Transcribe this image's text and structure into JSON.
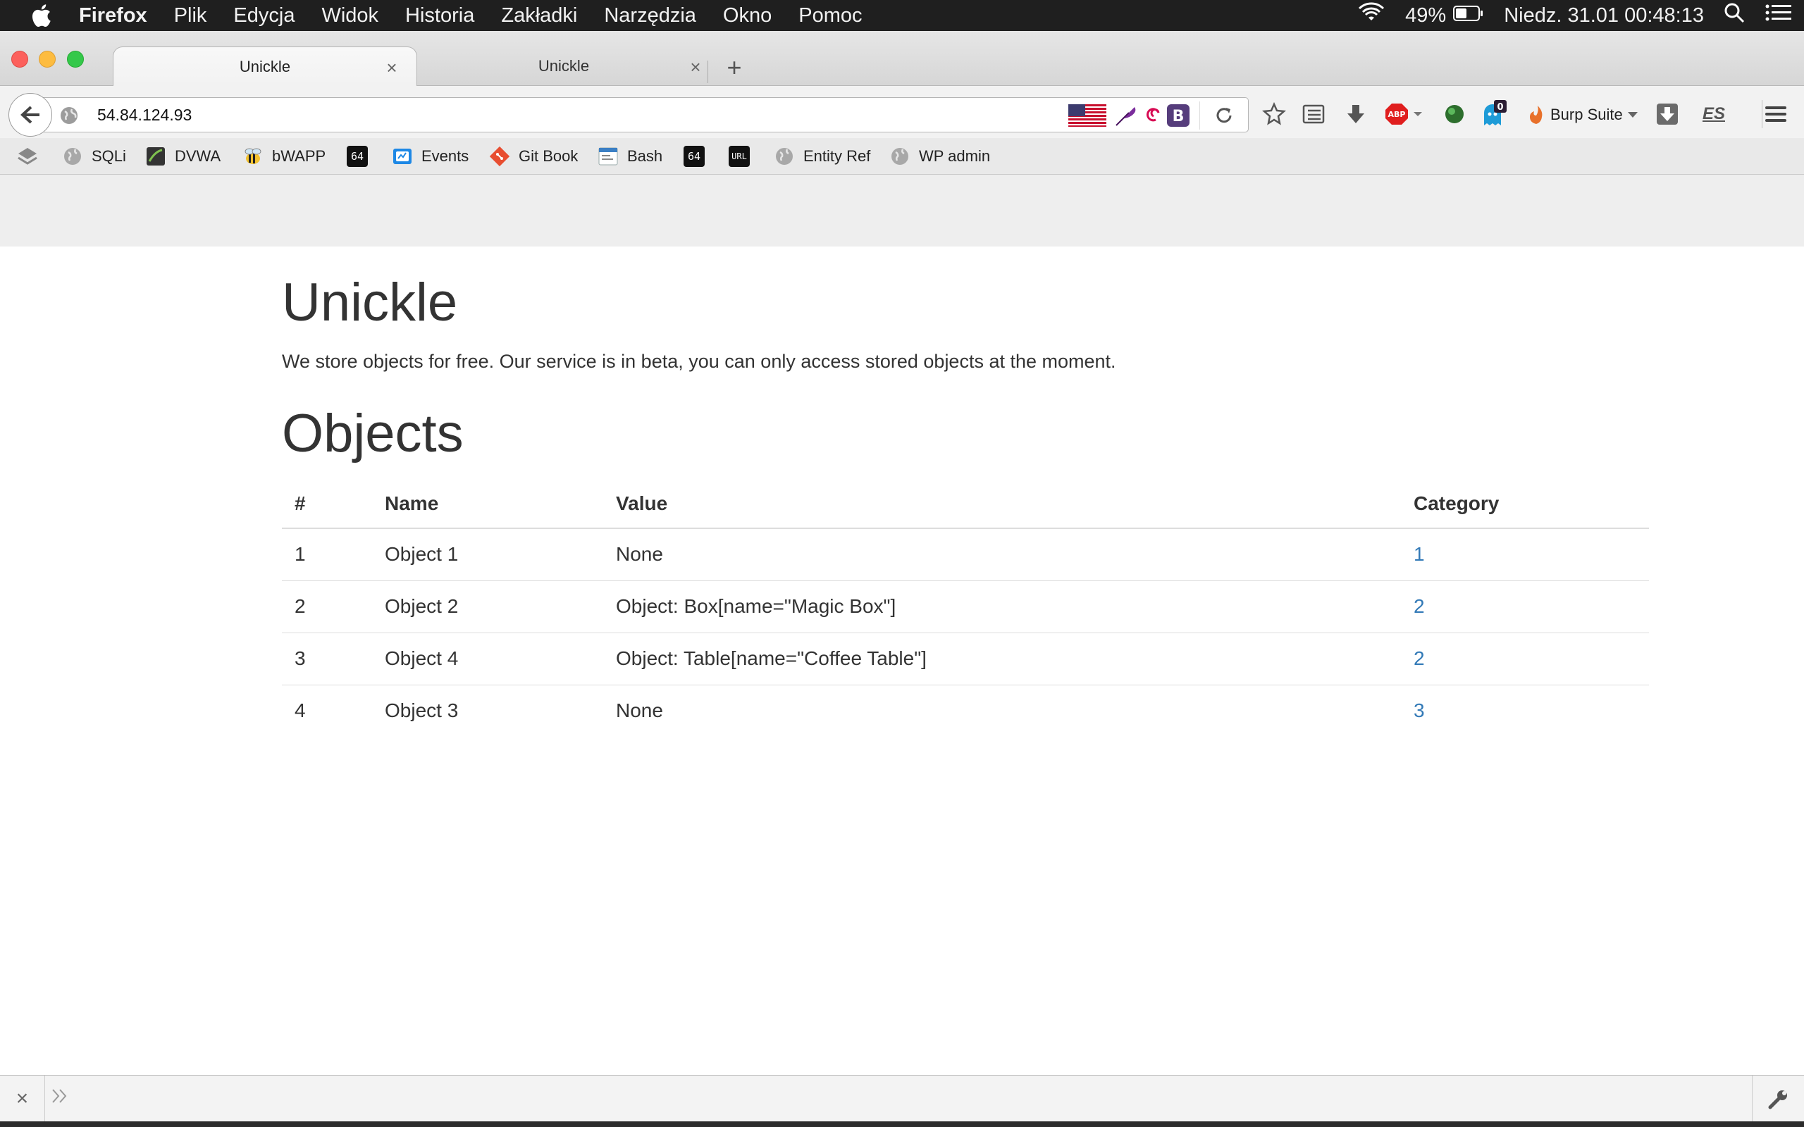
{
  "menubar": {
    "app": "Firefox",
    "items": [
      "Plik",
      "Edycja",
      "Widok",
      "Historia",
      "Zakładki",
      "Narzędzia",
      "Okno",
      "Pomoc"
    ],
    "battery": "49%",
    "datetime": "Niedz. 31.01  00:48:13"
  },
  "tabs": [
    {
      "title": "Unickle",
      "active": true
    },
    {
      "title": "Unickle",
      "active": false
    }
  ],
  "navbar": {
    "url": "54.84.124.93",
    "burp_label": "Burp Suite",
    "badge_count": "0",
    "es_label": "ES",
    "abp_label": "ABP",
    "b_label": "B"
  },
  "bookmarks": [
    {
      "label": "",
      "icon": "layers-icon"
    },
    {
      "label": "SQLi",
      "icon": "globe-icon"
    },
    {
      "label": "DVWA",
      "icon": "dvwa-icon"
    },
    {
      "label": "bWAPP",
      "icon": "bee-icon"
    },
    {
      "label": "",
      "icon": "64",
      "tag": "64"
    },
    {
      "label": "Events",
      "icon": "events-icon"
    },
    {
      "label": "Git Book",
      "icon": "git-icon"
    },
    {
      "label": "Bash",
      "icon": "bash-icon"
    },
    {
      "label": "",
      "icon": "64",
      "tag": "64"
    },
    {
      "label": "",
      "icon": "url",
      "tag": "URL"
    },
    {
      "label": "Entity Ref",
      "icon": "globe-icon"
    },
    {
      "label": "WP admin",
      "icon": "globe-icon"
    }
  ],
  "page": {
    "title": "Unickle",
    "lead": "We store objects for free. Our service is in beta, you can only access stored objects at the moment.",
    "section_title": "Objects",
    "table": {
      "headers": [
        "#",
        "Name",
        "Value",
        "Category"
      ],
      "rows": [
        {
          "id": "1",
          "name": "Object 1",
          "value": "None",
          "category": "1"
        },
        {
          "id": "2",
          "name": "Object 2",
          "value": "Object: Box[name=\"Magic Box\"]",
          "category": "2"
        },
        {
          "id": "3",
          "name": "Object 4",
          "value": "Object: Table[name=\"Coffee Table\"]",
          "category": "2"
        },
        {
          "id": "4",
          "name": "Object 3",
          "value": "None",
          "category": "3"
        }
      ]
    }
  },
  "colors": {
    "link": "#337ab7",
    "text": "#333333",
    "menubar": "#1f1f1f",
    "page_header_band": "#eeeeee"
  }
}
